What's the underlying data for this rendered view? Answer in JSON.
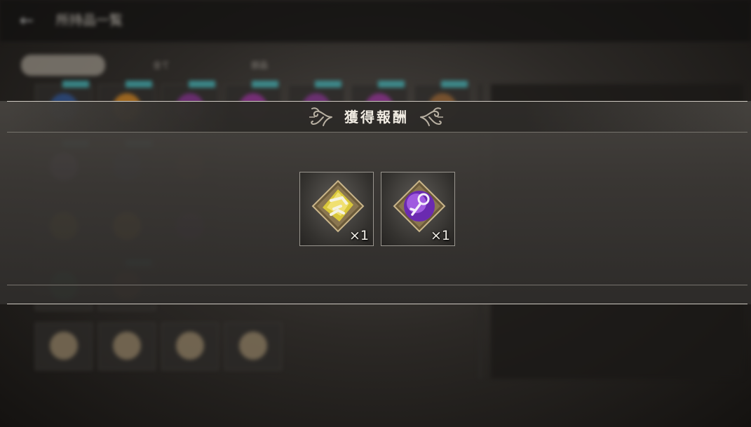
{
  "background": {
    "back_glyph": "←",
    "screen_title": "所持品一覧",
    "tabs": [
      "",
      "全て",
      "部品"
    ]
  },
  "dialog": {
    "title": "獲得報酬",
    "ornament_icon": "filigree-ornament-icon"
  },
  "rewards": [
    {
      "icon": "gold-crystal-shard-icon",
      "quantity": "×1",
      "color": "#d9c73a"
    },
    {
      "icon": "purple-crystal-key-icon",
      "quantity": "×1",
      "color": "#8a3fd0"
    }
  ],
  "colors": {
    "band": "#3f3c39",
    "line_light": "#cfcac2",
    "title_text": "#f0ebe2"
  }
}
